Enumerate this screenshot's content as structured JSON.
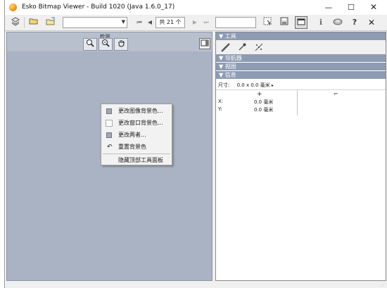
{
  "window": {
    "title": "Esko Bitmap Viewer - Build 1020 (Java 1.6.0_17)",
    "minimize_glyph": "—",
    "maximize_glyph": "☐",
    "close_glyph": "✕"
  },
  "toolbar": {
    "page_count_text": "共 21 个",
    "icons": [
      "layers-icon",
      "open-folder-icon",
      "export-icon",
      "first-page-icon",
      "prev-page-icon",
      "next-page-icon",
      "last-page-icon",
      "select-icon",
      "save-icon",
      "toggle-panel-icon",
      "info-icon",
      "globe-icon",
      "help-icon",
      "exit-icon"
    ],
    "first_glyph": "⏮",
    "prev_glyph": "◀",
    "next_glyph": "▶",
    "last_glyph": "⏭",
    "combo_arrow": "▼",
    "help_glyph": "?",
    "info_glyph": "ℹ",
    "exit_glyph": "✕"
  },
  "canvas": {
    "zoom_label": "检测",
    "colors": {
      "background": "#a9b3c4",
      "toolbar_band": "#b8c0ce"
    }
  },
  "context_menu": {
    "items": [
      {
        "label": "更改图像背景色...",
        "icon": "swatch"
      },
      {
        "label": "更改窗口背景色...",
        "icon": "swatch-white"
      },
      {
        "label": "更改两者...",
        "icon": "swatch"
      },
      {
        "label": "重置背景色",
        "icon": "undo-icon"
      },
      {
        "label": "隐藏顶部工具面板",
        "icon": ""
      }
    ],
    "undo_glyph": "↶"
  },
  "side_panel": {
    "sections": {
      "tools": "▼ 工具",
      "navigator": "▼ 导航器",
      "view": "▼ 视图",
      "info": "▼ 信息"
    },
    "header_color": "#8d9bb3",
    "info": {
      "size_label": "尺寸:",
      "size_value": "0.0 x 0.0 毫米",
      "size_caret": "▸",
      "cross_glyph": "+",
      "corner_glyph": "⌐",
      "x_label": "X:",
      "x_value": "0.0 毫米",
      "y_label": "Y:",
      "y_value": "0.0 毫米"
    }
  },
  "status": {
    "grip_glyph": "⋰"
  }
}
